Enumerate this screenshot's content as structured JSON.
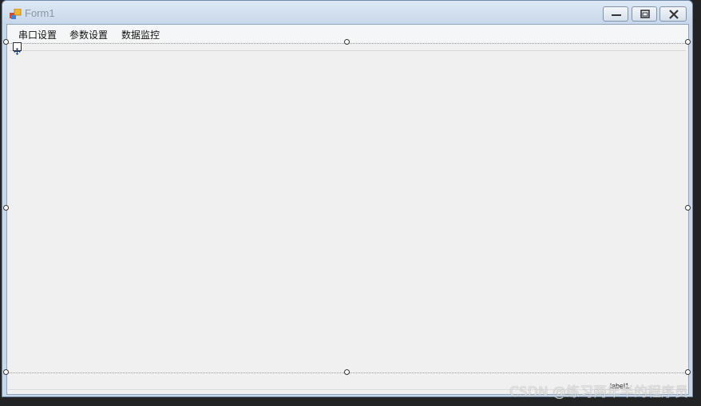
{
  "window": {
    "title": "Form1",
    "icons": {
      "app": "windows-forms-app-icon",
      "minimize": "minimize-icon",
      "maximize": "maximize-icon",
      "close": "close-icon",
      "move": "move-handle-icon"
    }
  },
  "menu": {
    "items": [
      {
        "label": "串口设置"
      },
      {
        "label": "参数设置"
      },
      {
        "label": "数据监控"
      }
    ]
  },
  "form": {
    "label1": "label1"
  },
  "watermark": "CSDN @练习两年半的程序员",
  "colors": {
    "client_bg": "#f0f0f0",
    "title_bar": "#c9d9ea",
    "dark_bg": "#222324"
  }
}
